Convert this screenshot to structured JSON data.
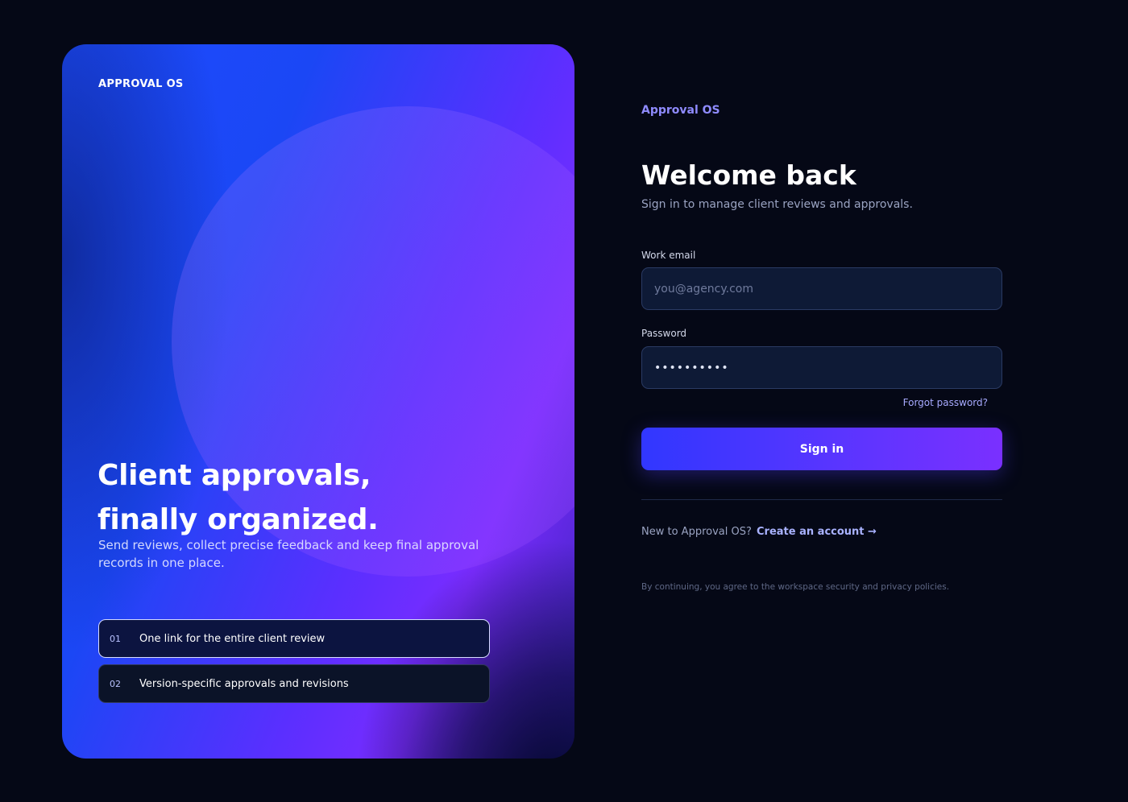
{
  "hero": {
    "brand": "APPROVAL OS",
    "title_line1": "Client approvals,",
    "title_line2": "finally organized.",
    "subtitle": "Send reviews, collect precise feedback and keep final approval records in one place.",
    "features": [
      {
        "number": "01",
        "text": "One link for the entire client review"
      },
      {
        "number": "02",
        "text": "Version-specific approvals and revisions"
      }
    ]
  },
  "auth": {
    "brand": "Approval OS",
    "title": "Welcome back",
    "subtitle": "Sign in to manage client reviews and approvals.",
    "email_label": "Work email",
    "email_placeholder": "you@agency.com",
    "password_label": "Password",
    "password_value": "••••••••••",
    "forgot_label": "Forgot password?",
    "signin_label": "Sign in",
    "signup_prompt": "New to Approval OS?",
    "signup_link": "Create an account →",
    "legal": "By continuing, you agree to the workspace security and privacy policies."
  },
  "colors": {
    "background": "#050816",
    "accent": "#5a35ff",
    "brand_text": "#8f8bff",
    "link": "#a9b2ff"
  }
}
